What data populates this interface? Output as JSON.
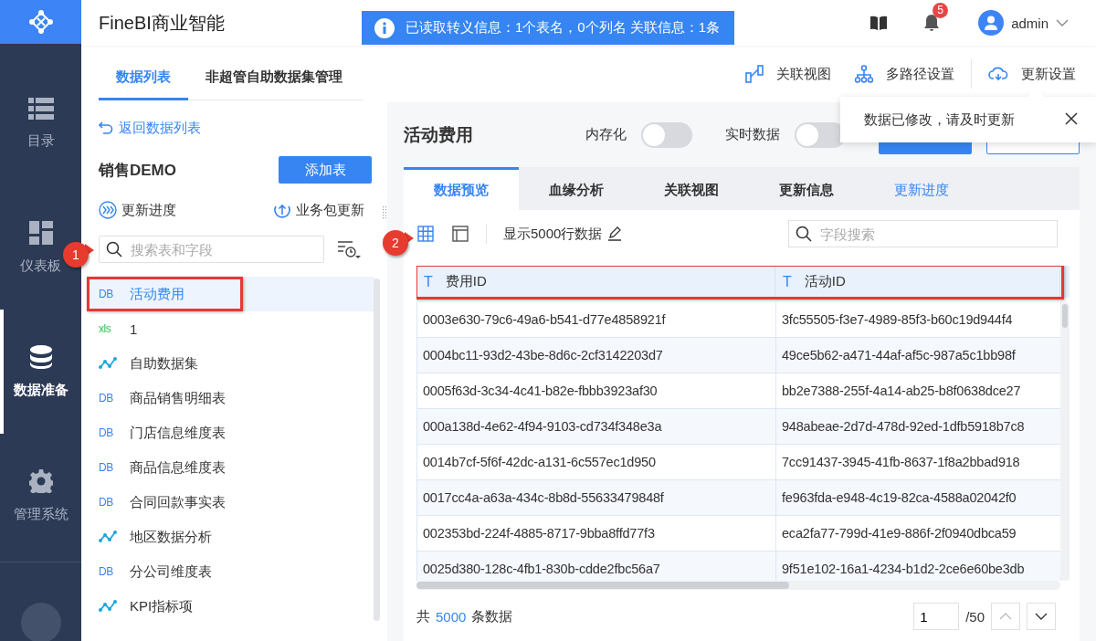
{
  "app": {
    "title": "FineBI商业智能"
  },
  "toast": {
    "text": "已读取转义信息：1个表名，0个列名 关联信息：1条"
  },
  "header": {
    "notifications": "5",
    "user": "admin"
  },
  "nav": [
    {
      "label": "目录",
      "selected": false
    },
    {
      "label": "仪表板",
      "selected": false
    },
    {
      "label": "数据准备",
      "selected": true
    },
    {
      "label": "管理系统",
      "selected": false
    }
  ],
  "left_tabs": [
    {
      "label": "数据列表",
      "selected": true
    },
    {
      "label": "非超管自助数据集管理",
      "selected": false
    }
  ],
  "back_link": "返回数据列表",
  "package": {
    "name": "销售DEMO",
    "add_button": "添加表",
    "update_progress": "更新进度",
    "package_update": "业务包更新"
  },
  "table_search": {
    "placeholder": "搜索表和字段"
  },
  "tables": [
    {
      "name": "活动费用",
      "kind": "db",
      "icon_text": "DB",
      "selected": true,
      "highlighted": true
    },
    {
      "name": "1",
      "kind": "xls",
      "icon_text": "xls",
      "selected": false,
      "highlighted": false
    },
    {
      "name": "自助数据集",
      "kind": "dataset",
      "selected": false,
      "highlighted": false
    },
    {
      "name": "商品销售明细表",
      "kind": "db",
      "icon_text": "DB",
      "selected": false,
      "highlighted": false
    },
    {
      "name": "门店信息维度表",
      "kind": "db",
      "icon_text": "DB",
      "selected": false,
      "highlighted": false
    },
    {
      "name": "商品信息维度表",
      "kind": "db",
      "icon_text": "DB",
      "selected": false,
      "highlighted": false
    },
    {
      "name": "合同回款事实表",
      "kind": "db",
      "icon_text": "DB",
      "selected": false,
      "highlighted": false
    },
    {
      "name": "地区数据分析",
      "kind": "dataset",
      "selected": false,
      "highlighted": false
    },
    {
      "name": "分公司维度表",
      "kind": "db",
      "icon_text": "DB",
      "selected": false,
      "highlighted": false
    },
    {
      "name": "KPI指标项",
      "kind": "dataset",
      "selected": false,
      "highlighted": false
    }
  ],
  "toolbar": [
    {
      "label": "关联视图"
    },
    {
      "label": "多路径设置"
    },
    {
      "label": "更新设置"
    }
  ],
  "popover": {
    "text": "数据已修改，请及时更新"
  },
  "dataset": {
    "title": "活动费用",
    "switches": [
      {
        "label": "内存化",
        "on": false
      },
      {
        "label": "实时数据",
        "on": false
      }
    ]
  },
  "tabs": [
    {
      "label": "数据预览",
      "kind": "tab",
      "selected": true
    },
    {
      "label": "血缘分析",
      "kind": "tab",
      "selected": false
    },
    {
      "label": "关联视图",
      "kind": "tab",
      "selected": false
    },
    {
      "label": "更新信息",
      "kind": "tab",
      "selected": false
    },
    {
      "label": "更新进度",
      "kind": "link",
      "selected": false
    }
  ],
  "preview": {
    "views": [
      {
        "selected": true
      },
      {
        "selected": false
      }
    ],
    "row_limit": "显示5000行数据",
    "field_search": {
      "placeholder": "字段搜索"
    }
  },
  "table": {
    "highlighted": true,
    "columns": [
      {
        "type": "T",
        "name": "费用ID"
      },
      {
        "type": "T",
        "name": "活动ID"
      }
    ],
    "rows": [
      [
        "0003e630-79c6-49a6-b541-d77e4858921f",
        "3fc55505-f3e7-4989-85f3-b60c19d944f4"
      ],
      [
        "0004bc11-93d2-43be-8d6c-2cf3142203d7",
        "49ce5b62-a471-44af-af5c-987a5c1bb98f"
      ],
      [
        "0005f63d-3c34-4c41-b82e-fbbb3923af30",
        "bb2e7388-255f-4a14-ab25-b8f0638dce27"
      ],
      [
        "000a138d-4e62-4f94-9103-cd734f348e3a",
        "948abeae-2d7d-478d-92ed-1dfb5918b7c8"
      ],
      [
        "0014b7cf-5f6f-42dc-a131-6c557ec1d950",
        "7cc91437-3945-41fb-8637-1f8a2bbad918"
      ],
      [
        "0017cc4a-a63a-434c-8b8d-55633479848f",
        "fe963fda-e948-4c19-82ca-4588a02042f0"
      ],
      [
        "002353bd-224f-4885-8717-9bba8ffd77f3",
        "eca2fa77-799d-41e9-886f-2f0940dbca59"
      ],
      [
        "0025d380-128c-4fb1-830b-cdde2fbc56a7",
        "9f51e102-16a1-4234-b1d2-2ce6e60be3db"
      ]
    ]
  },
  "footer": {
    "prefix": "共",
    "count": "5000",
    "suffix": "条数据",
    "page": "1",
    "pages": "/50"
  },
  "annotations": [
    {
      "number": "1"
    },
    {
      "number": "2"
    }
  ]
}
